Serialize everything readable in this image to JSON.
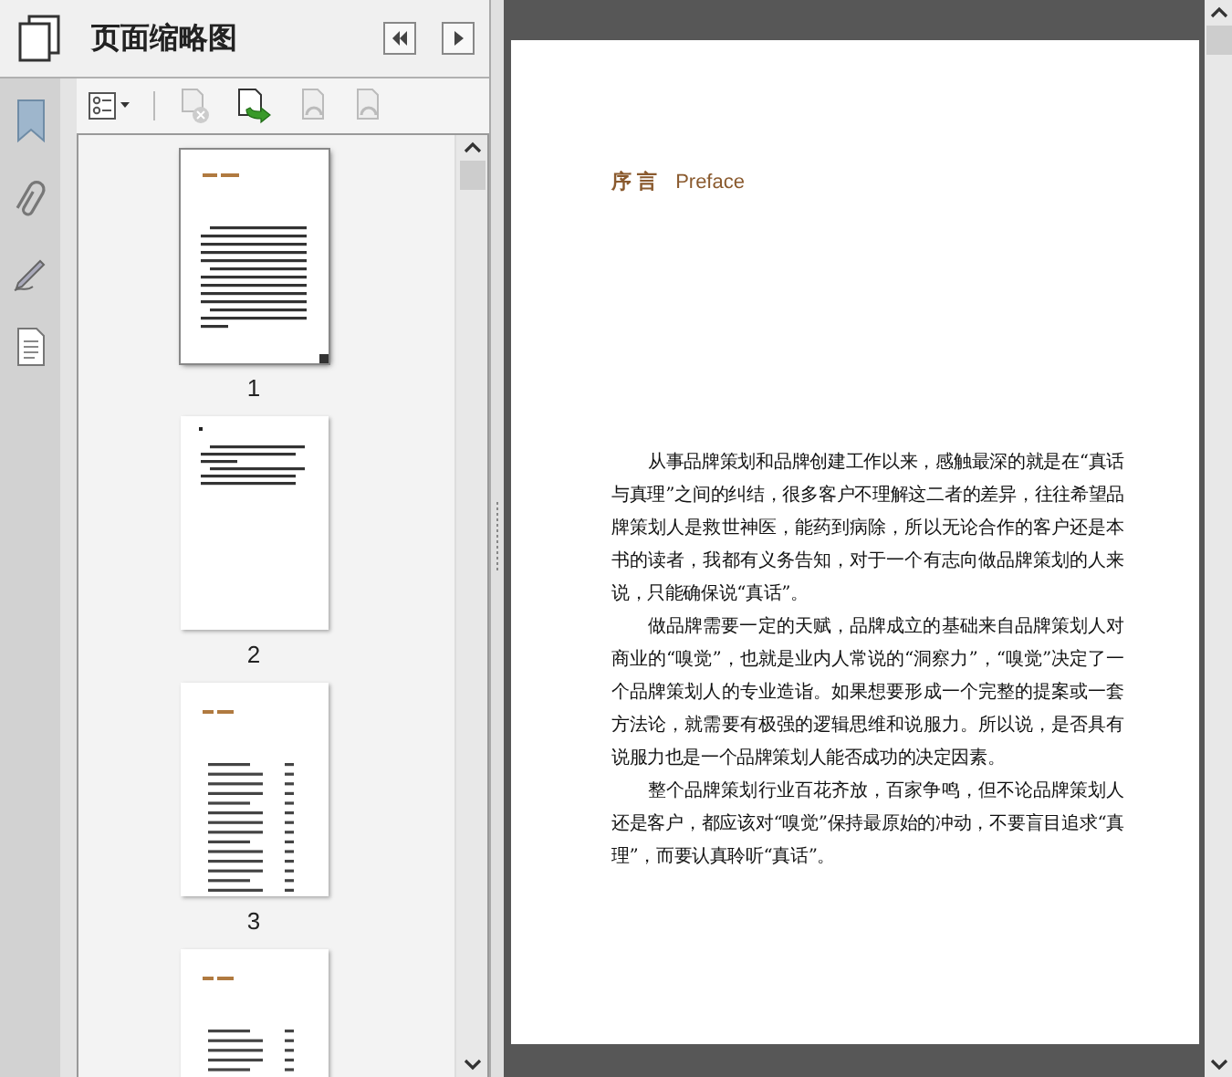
{
  "panel": {
    "title": "页面缩略图"
  },
  "thumbnails": [
    {
      "label": "1",
      "selected": true,
      "kind": "text"
    },
    {
      "label": "2",
      "selected": false,
      "kind": "short"
    },
    {
      "label": "3",
      "selected": false,
      "kind": "contents"
    },
    {
      "selected": false,
      "kind": "contents"
    }
  ],
  "document": {
    "heading": "序 言",
    "heading_en": "Preface",
    "paragraphs": [
      "从事品牌策划和品牌创建工作以来，感触最深的就是在“真话与真理”之间的纠结，很多客户不理解这二者的差异，往往希望品牌策划人是救世神医，能药到病除，所以无论合作的客户还是本书的读者，我都有义务告知，对于一个有志向做品牌策划的人来说，只能确保说“真话”。",
      "做品牌需要一定的天赋，品牌成立的基础来自品牌策划人对商业的“嗅觉”，也就是业内人常说的“洞察力”，“嗅觉”决定了一个品牌策划人的专业造诣。如果想要形成一个完整的提案或一套方法论，就需要有极强的逻辑思维和说服力。所以说，是否具有说服力也是一个品牌策划人能否成功的决定因素。",
      "整个品牌策划行业百花齐放，百家争鸣，但不论品牌策划人还是客户，都应该对“嗅觉”保持最原始的冲动，不要盲目追求“真理”，而要认真聆听“真话”。"
    ]
  }
}
